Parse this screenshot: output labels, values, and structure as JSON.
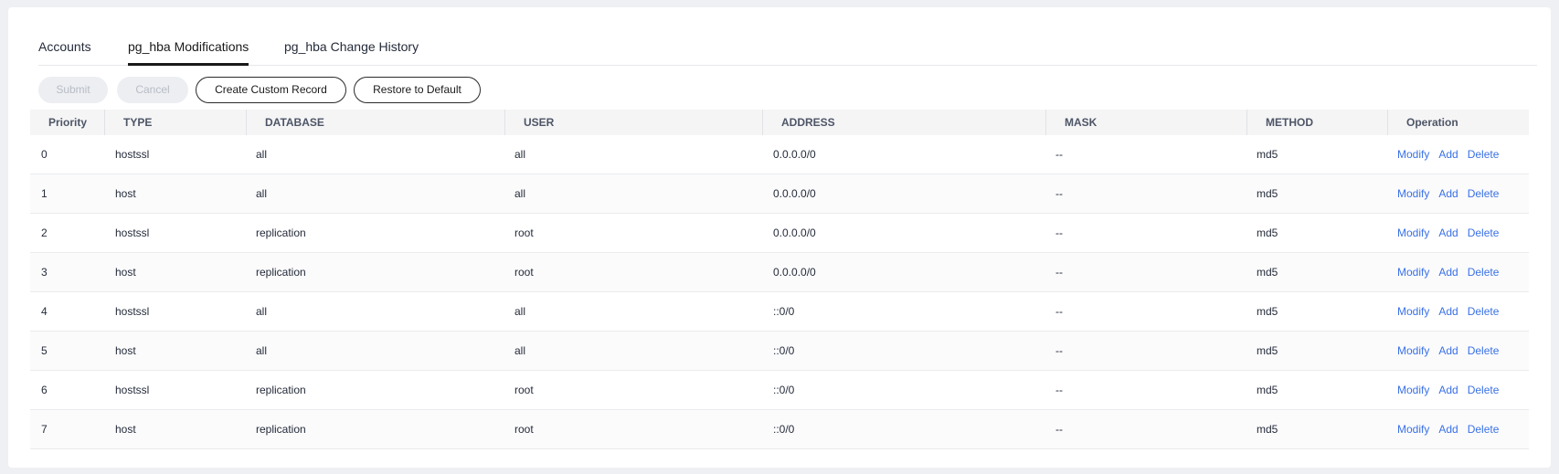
{
  "tabs": [
    {
      "label": "Accounts",
      "active": false
    },
    {
      "label": "pg_hba Modifications",
      "active": true
    },
    {
      "label": "pg_hba Change History",
      "active": false
    }
  ],
  "toolbar": {
    "submit_label": "Submit",
    "cancel_label": "Cancel",
    "create_label": "Create Custom Record",
    "restore_label": "Restore to Default"
  },
  "table": {
    "headers": [
      "Priority",
      "TYPE",
      "DATABASE",
      "USER",
      "ADDRESS",
      "MASK",
      "METHOD",
      "Operation"
    ],
    "rows": [
      {
        "priority": "0",
        "type": "hostssl",
        "database": "all",
        "user": "all",
        "address": "0.0.0.0/0",
        "mask": "--",
        "method": "md5"
      },
      {
        "priority": "1",
        "type": "host",
        "database": "all",
        "user": "all",
        "address": "0.0.0.0/0",
        "mask": "--",
        "method": "md5"
      },
      {
        "priority": "2",
        "type": "hostssl",
        "database": "replication",
        "user": "root",
        "address": "0.0.0.0/0",
        "mask": "--",
        "method": "md5"
      },
      {
        "priority": "3",
        "type": "host",
        "database": "replication",
        "user": "root",
        "address": "0.0.0.0/0",
        "mask": "--",
        "method": "md5"
      },
      {
        "priority": "4",
        "type": "hostssl",
        "database": "all",
        "user": "all",
        "address": "::0/0",
        "mask": "--",
        "method": "md5"
      },
      {
        "priority": "5",
        "type": "host",
        "database": "all",
        "user": "all",
        "address": "::0/0",
        "mask": "--",
        "method": "md5"
      },
      {
        "priority": "6",
        "type": "hostssl",
        "database": "replication",
        "user": "root",
        "address": "::0/0",
        "mask": "--",
        "method": "md5"
      },
      {
        "priority": "7",
        "type": "host",
        "database": "replication",
        "user": "root",
        "address": "::0/0",
        "mask": "--",
        "method": "md5"
      }
    ],
    "operations": {
      "modify": "Modify",
      "add": "Add",
      "delete": "Delete"
    }
  },
  "colors": {
    "link": "#3a71e6",
    "active_tab": "#191919",
    "header_bg": "#f5f5f6"
  }
}
